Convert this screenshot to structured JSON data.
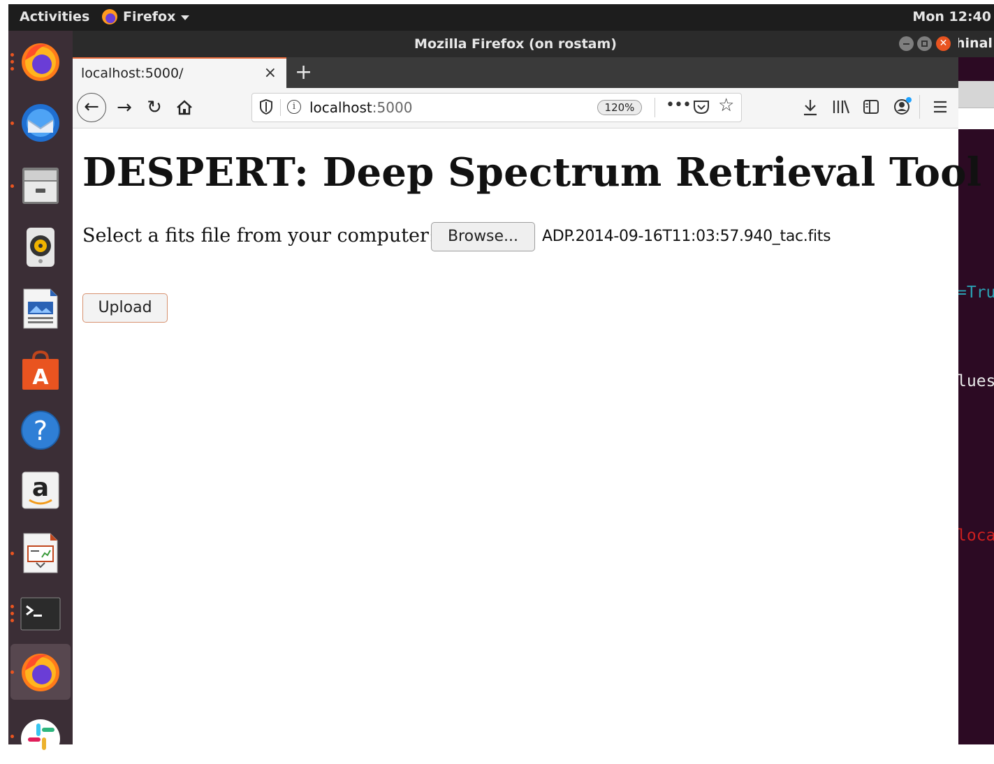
{
  "topbar": {
    "activities": "Activities",
    "app_name": "Firefox",
    "clock": "Mon 12:40"
  },
  "dock": {
    "items": [
      {
        "name": "firefox",
        "running": true
      },
      {
        "name": "thunderbird",
        "running": true
      },
      {
        "name": "files",
        "running": true
      },
      {
        "name": "rhythmbox",
        "running": false
      },
      {
        "name": "libreoffice-writer",
        "running": false
      },
      {
        "name": "ubuntu-software",
        "running": false
      },
      {
        "name": "help",
        "running": false
      },
      {
        "name": "amazon",
        "running": false
      },
      {
        "name": "libreoffice-impress",
        "running": true
      },
      {
        "name": "terminal",
        "running": true
      },
      {
        "name": "firefox",
        "running": true,
        "active": true
      },
      {
        "name": "slack",
        "running": true
      }
    ],
    "amazon_letter": "a",
    "help_symbol": "?"
  },
  "window": {
    "title": "Mozilla Firefox (on rostam)"
  },
  "terminal_peek": {
    "title_fragment": "hinal",
    "lines": [
      {
        "text": "=Tru",
        "color": "#2aa1b3"
      },
      {
        "text": "lues",
        "color": "#e8e8e8"
      },
      {
        "text": "loca",
        "color": "#cc1f1f"
      }
    ]
  },
  "tab": {
    "label": "localhost:5000/",
    "close": "×",
    "new_tab": "+"
  },
  "nav": {
    "url_host": "localhost",
    "url_port": ":5000",
    "zoom": "120%",
    "more": "•••"
  },
  "page": {
    "heading": "DESPERT: Deep Spectrum Retrieval Tool",
    "prompt": "Select a fits file from your computer:",
    "browse_label": "Browse...",
    "selected_file": "ADP.2014-09-16T11:03:57.940_tac.fits",
    "upload_label": "Upload"
  },
  "colors": {
    "accent": "#e95420",
    "dock_bg": "#3b2e36",
    "topbar_bg": "#1d1d1d",
    "terminal_bg": "#2c0a23"
  }
}
